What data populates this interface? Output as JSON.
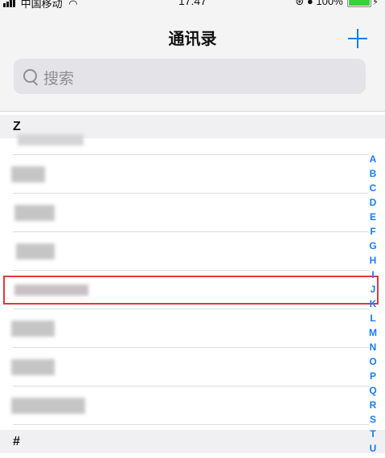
{
  "status_bar": {
    "carrier": "中国移动",
    "time": "17:47",
    "battery_percent": "100%"
  },
  "nav": {
    "title": "通讯录",
    "add_icon": "plus-icon"
  },
  "search": {
    "placeholder": "搜索",
    "icon": "search-icon"
  },
  "sections": {
    "z_header": "Z",
    "hash_header": "#"
  },
  "contacts_note": "names obscured",
  "index_letters": [
    "A",
    "B",
    "C",
    "D",
    "E",
    "F",
    "G",
    "H",
    "I",
    "J",
    "K",
    "L",
    "M",
    "N",
    "O",
    "P",
    "Q",
    "R",
    "S",
    "T",
    "U"
  ],
  "colors": {
    "accent": "#1a7cf5",
    "highlight": "#e0383e"
  }
}
